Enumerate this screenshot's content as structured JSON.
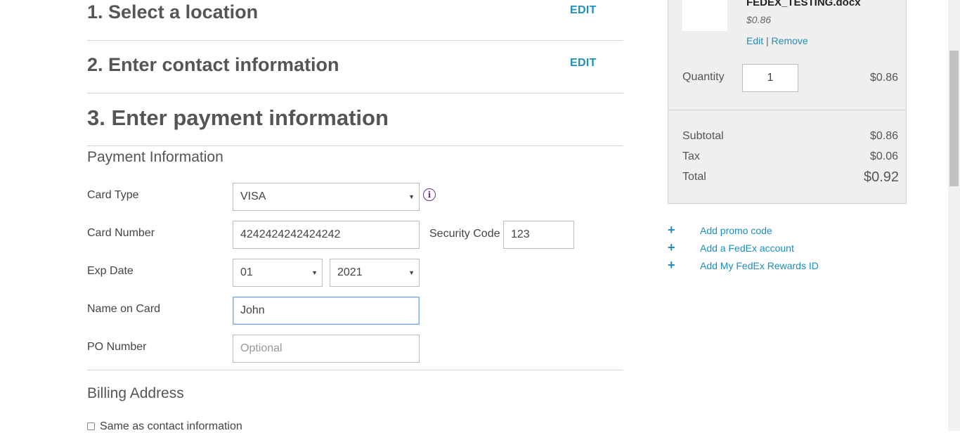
{
  "steps": {
    "step1_title": "1. Select a location",
    "step1_edit": "EDIT",
    "step2_title": "2. Enter contact information",
    "step2_edit": "EDIT",
    "step3_title": "3. Enter payment information"
  },
  "payment": {
    "section_title": "Payment Information",
    "card_type_label": "Card Type",
    "card_type_value": "VISA",
    "card_number_label": "Card Number",
    "card_number_value": "4242424242424242",
    "security_code_label": "Security Code",
    "security_code_value": "123",
    "exp_date_label": "Exp Date",
    "exp_month_value": "01",
    "exp_year_value": "2021",
    "name_label": "Name on Card",
    "name_value": "John",
    "po_label": "PO Number",
    "po_placeholder": "Optional"
  },
  "billing": {
    "section_title": "Billing Address",
    "same_as_contact_label": "Same as contact information"
  },
  "cart": {
    "file_name": "FEDEX_TESTING.docx",
    "file_price": "$0.86",
    "edit_label": "Edit",
    "separator": "|",
    "remove_label": "Remove",
    "quantity_label": "Quantity",
    "quantity_value": "1",
    "line_total": "$0.86",
    "subtotal_label": "Subtotal",
    "subtotal_value": "$0.86",
    "tax_label": "Tax",
    "tax_value": "$0.06",
    "total_label": "Total",
    "total_value": "$0.92"
  },
  "extras": {
    "promo_label": "Add promo code",
    "fedex_account_label": "Add a FedEx account",
    "rewards_label": "Add My FedEx Rewards ID"
  },
  "icons": {
    "info": "info-icon",
    "select_arrow": "chevron-down-icon",
    "plus": "plus-icon"
  },
  "colors": {
    "link": "#1b8fbd",
    "info_icon": "#6b2c91",
    "cart_bg": "#efefef"
  }
}
